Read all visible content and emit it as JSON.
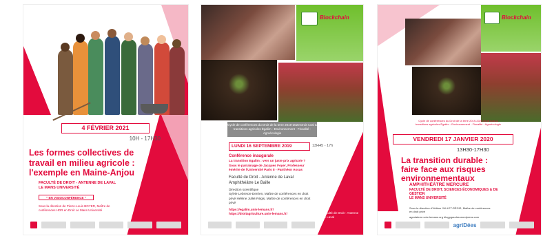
{
  "posters": [
    {
      "date": "4 FÉVRIER 2021",
      "time": "10H - 17H30",
      "title": "Les formes collectives de travail en milieu agricole : l'exemple en Maine-Anjou",
      "place_line1": "FACULTÉ DE DROIT - ANTENNE DE LAVAL",
      "place_line2": "LE MANS UNIVERSITÉ",
      "note": "\" EN VISIOCONFÉRENCE \"",
      "direction": "Sous la direction de Pierre-Louis BOYER, Maître de conférences HDR en Droit Le Mans Université"
    },
    {
      "banner": "Cycle de conférences du Droit de la terre 2019-2020 Droit rural & transitions agricoles Égalim - Environnement - Fiscalité - Agroécologie",
      "blockchain": "Blockchain",
      "date": "LUNDI 16 SEPTEMBRE 2019",
      "time": "13H45 - 17h",
      "conference": "Conférence inaugurale",
      "subject": "La transition Egalim : vers un juste prix agricole ?",
      "patronage": "Sous le parrainage de Jacques Foyer, Professeur émérite de l'Université Paris II - Panthéon Assas",
      "place_line1": "Faculté de Droit - Antenne de Laval",
      "place_line2": "Amphithéâtre Le Baille",
      "direction_label": "Direction scientifique",
      "direction": "Sylvie Lebreton-Derrien, Maître de conférences en droit privé Hélène Jullet-Régis, Maître de conférences en droit privé",
      "link1": "https://egalim.univ-lemans.fr/",
      "link2": "https://droitagriculture.univ-lemans.fr/",
      "faculty_logo": "Faculté de Droit - Antenne de Laval"
    },
    {
      "banner": "Cycle de conférences du Droit de la terre 2019-2020 Droit rural & transitions agricoles Égalim - Environnement - Fiscalité - Agroécologie",
      "blockchain": "Blockchain",
      "date": "VENDREDI 17 JANVIER 2020",
      "time": "13H30-17H30",
      "title": "La transition durable : faire face aux risques environnementaux",
      "amphi": "AMPHITHÉÂTRE MERCURE",
      "amphi_sub1": "FACULTÉ DE DROIT, SCIENCES ÉCONOMIQUES & DE GESTION",
      "amphi_sub2": "LE MANS UNIVERSITÉ",
      "direction": "Sous la direction d'Hélène JULLET-RÉGIS, Maître de conférences en droit privé",
      "links": "agrolaterre.univ-lemans.org blogpgaudes.wordpress.com",
      "logo_text": "agriDées"
    }
  ],
  "colors": {
    "accent": "#e30b3d",
    "green": "#6fbf2c"
  }
}
